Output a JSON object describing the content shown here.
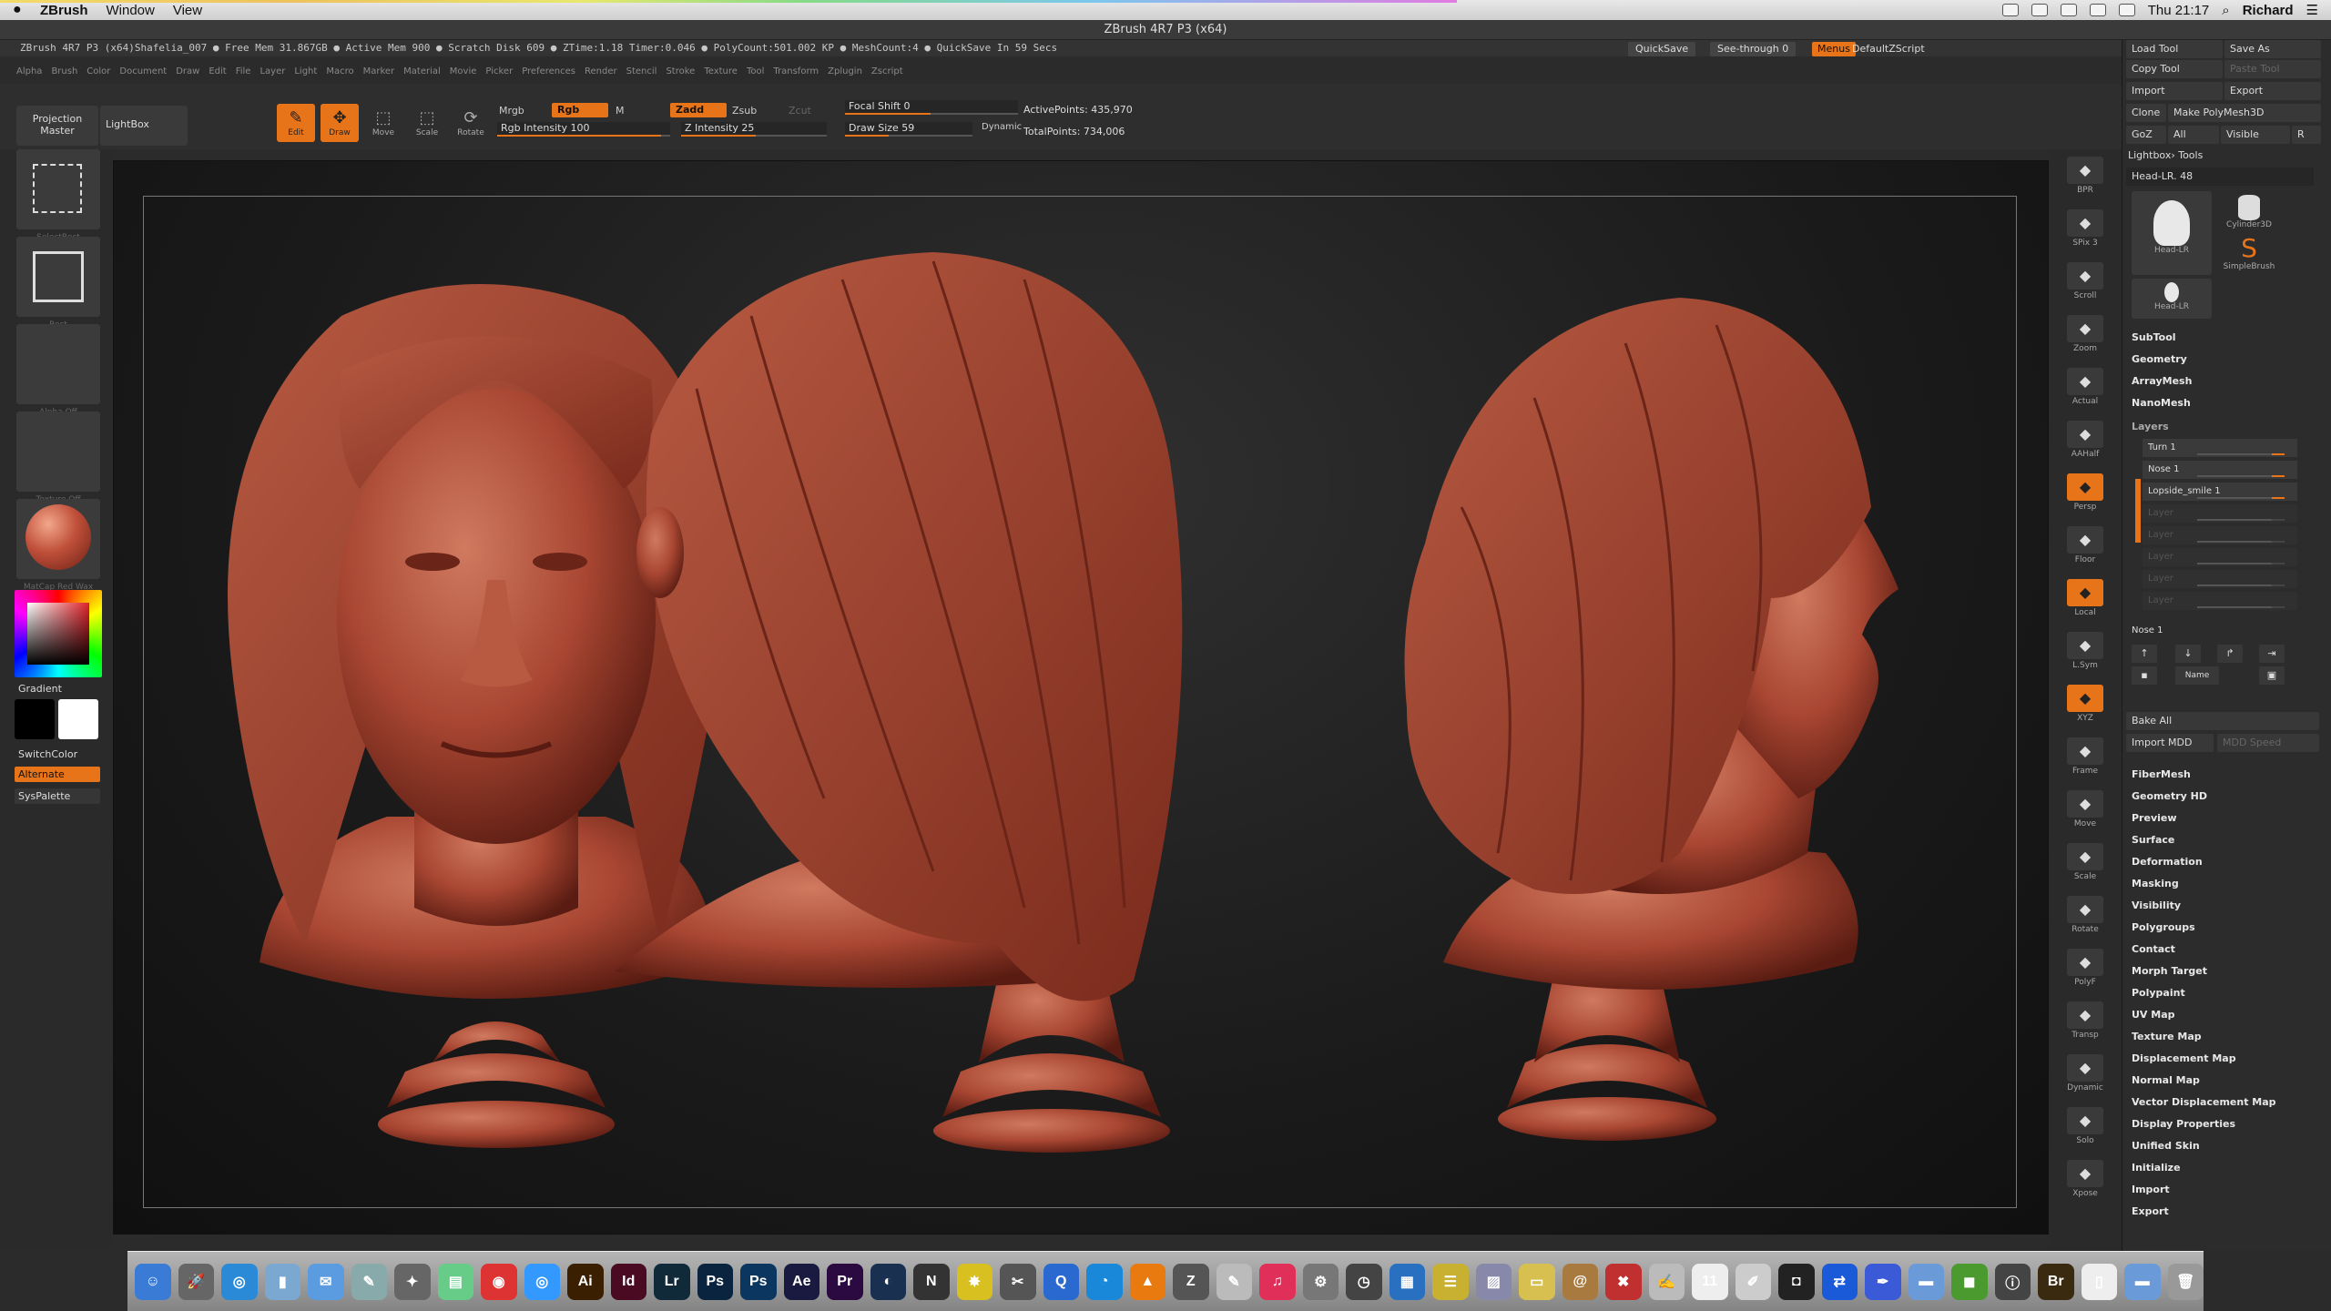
{
  "menubar": {
    "app_name": "ZBrush",
    "items": [
      "Window",
      "View"
    ],
    "clock": "Thu 21:17",
    "user": "Richard"
  },
  "window_title": "ZBrush 4R7 P3 (x64)",
  "info_strip": "ZBrush 4R7 P3 (x64)Shafelia_007   ● Free Mem 31.867GB ● Active Mem 900 ● Scratch Disk 609 ● ZTime:1.18 Timer:0.046 ● PolyCount:501.002 KP ● MeshCount:4 ● QuickSave In 59 Secs",
  "header_right": {
    "quicksave": "QuickSave",
    "see_through": "See-through  0",
    "menus": "Menus",
    "script": "DefaultZScript"
  },
  "menu_names": [
    "Alpha",
    "Brush",
    "Color",
    "Document",
    "Draw",
    "Edit",
    "File",
    "Layer",
    "Light",
    "Macro",
    "Marker",
    "Material",
    "Movie",
    "Picker",
    "Preferences",
    "Render",
    "Stencil",
    "Stroke",
    "Texture",
    "Tool",
    "Transform",
    "Zplugin",
    "Zscript"
  ],
  "toolbar": {
    "projection_master": "Projection Master",
    "lightbox": "LightBox",
    "edit": "Edit",
    "draw": "Draw",
    "move": "Move",
    "scale": "Scale",
    "rotate": "Rotate",
    "mrgb": "Mrgb",
    "rgb": "Rgb",
    "m": "M",
    "zadd": "Zadd",
    "zsub": "Zsub",
    "zcut": "Zcut",
    "rgb_intensity": "Rgb Intensity 100",
    "z_intensity": "Z Intensity 25",
    "focal_shift": "Focal Shift 0",
    "draw_size": "Draw Size 59",
    "dynamic": "Dynamic",
    "active_points": "ActivePoints: 435,970",
    "total_points": "TotalPoints: 734,006"
  },
  "left_shelf": {
    "select_rect": "SelectRect",
    "rect": "Rect",
    "alpha_off": "Alpha Off",
    "texture_off": "Texture Off",
    "matcap": "MatCap Red Wax",
    "gradient": "Gradient",
    "switch_color": "SwitchColor",
    "alternate": "Alternate",
    "syspalette": "SysPalette"
  },
  "right_shelf": [
    {
      "label": "BPR",
      "icon": "bpr-icon",
      "on": false
    },
    {
      "label": "SPix 3",
      "icon": "spix-icon",
      "on": false
    },
    {
      "label": "Scroll",
      "icon": "scroll-icon",
      "on": false
    },
    {
      "label": "Zoom",
      "icon": "zoom-icon",
      "on": false
    },
    {
      "label": "Actual",
      "icon": "actual-icon",
      "on": false
    },
    {
      "label": "AAHalf",
      "icon": "aahalf-icon",
      "on": false
    },
    {
      "label": "Persp",
      "icon": "persp-icon",
      "on": true
    },
    {
      "label": "Floor",
      "icon": "floor-icon",
      "on": false
    },
    {
      "label": "Local",
      "icon": "local-icon",
      "on": true
    },
    {
      "label": "L.Sym",
      "icon": "lsym-icon",
      "on": false
    },
    {
      "label": "XYZ",
      "icon": "xyz-icon",
      "on": true
    },
    {
      "label": "Frame",
      "icon": "frame-icon",
      "on": false
    },
    {
      "label": "Move",
      "icon": "move-icon",
      "on": false
    },
    {
      "label": "Scale",
      "icon": "scale-icon",
      "on": false
    },
    {
      "label": "Rotate",
      "icon": "rotate-icon",
      "on": false
    },
    {
      "label": "PolyF",
      "icon": "polyf-icon",
      "on": false
    },
    {
      "label": "Transp",
      "icon": "transp-icon",
      "on": false
    },
    {
      "label": "Dynamic",
      "icon": "dynamic-icon",
      "on": false
    },
    {
      "label": "Solo",
      "icon": "solo-icon",
      "on": false
    },
    {
      "label": "Xpose",
      "icon": "xpose-icon",
      "on": false
    }
  ],
  "right_panel": {
    "load_tool": "Load Tool",
    "save_as": "Save As",
    "copy_tool": "Copy Tool",
    "paste_tool": "Paste Tool",
    "import": "Import",
    "export": "Export",
    "clone": "Clone",
    "make_polymesh": "Make PolyMesh3D",
    "goz": "GoZ",
    "all": "All",
    "visible": "Visible",
    "r": "R",
    "lightbox_tools": "Lightbox› Tools",
    "head_slider": "Head-LR. 48",
    "thumb_head": "Head-LR",
    "thumb_cylinder": "Cylinder3D",
    "thumb_simplebrush": "SimpleBrush",
    "thumb_head2": "Head-LR",
    "sections_top": [
      "SubTool",
      "Geometry",
      "ArrayMesh",
      "NanoMesh"
    ],
    "layers_title": "Layers",
    "layers": [
      {
        "name": "Turn 1",
        "active": true
      },
      {
        "name": "Nose 1",
        "active": true
      },
      {
        "name": "Lopside_smile 1",
        "active": true
      },
      {
        "name": "Layer",
        "active": false
      },
      {
        "name": "Layer",
        "active": false
      },
      {
        "name": "Layer",
        "active": false
      },
      {
        "name": "Layer",
        "active": false
      },
      {
        "name": "Layer",
        "active": false
      }
    ],
    "nose_slider": "Nose 1",
    "name_btn": "Name",
    "bake_all": "Bake All",
    "import_mdd": "Import MDD",
    "mdd_speed": "MDD Speed",
    "sections_bottom": [
      "FiberMesh",
      "Geometry HD",
      "Preview",
      "Surface",
      "Deformation",
      "Masking",
      "Visibility",
      "Polygroups",
      "Contact",
      "Morph Target",
      "Polypaint",
      "UV Map",
      "Texture Map",
      "Displacement Map",
      "Normal Map",
      "Vector Displacement Map",
      "Display Properties",
      "Unified Skin",
      "Initialize",
      "Import",
      "Export"
    ]
  },
  "dock": [
    {
      "name": "finder-icon",
      "glyph": "☺",
      "color": "#3a7bd5"
    },
    {
      "name": "launchpad-icon",
      "glyph": "🚀",
      "color": "#666"
    },
    {
      "name": "safari-icon",
      "glyph": "◎",
      "color": "#2a8ad8"
    },
    {
      "name": "trash-icon-app",
      "glyph": "▮",
      "color": "#7aa8d0"
    },
    {
      "name": "mail-icon",
      "glyph": "✉",
      "color": "#5b9be0"
    },
    {
      "name": "preview-icon",
      "glyph": "✎",
      "color": "#8aa"
    },
    {
      "name": "app-icon",
      "glyph": "✦",
      "color": "#666"
    },
    {
      "name": "photos-icon",
      "glyph": "▤",
      "color": "#6c8"
    },
    {
      "name": "chrome-icon",
      "glyph": "◉",
      "color": "#d33"
    },
    {
      "name": "safari2-icon",
      "glyph": "◎",
      "color": "#39f"
    },
    {
      "name": "illustrator-icon",
      "glyph": "Ai",
      "color": "#3a1f00"
    },
    {
      "name": "indesign-icon",
      "glyph": "Id",
      "color": "#4a0a22"
    },
    {
      "name": "lightroom-icon",
      "glyph": "Lr",
      "color": "#102a3a"
    },
    {
      "name": "photoshop-icon",
      "glyph": "Ps",
      "color": "#0a2440"
    },
    {
      "name": "photoshop2-icon",
      "glyph": "Ps",
      "color": "#0a3660"
    },
    {
      "name": "aftereffects-icon",
      "glyph": "Ae",
      "color": "#1a1a40"
    },
    {
      "name": "premiere-icon",
      "glyph": "Pr",
      "color": "#2a0a40"
    },
    {
      "name": "cinema4d-icon",
      "glyph": "◐",
      "color": "#1a3050"
    },
    {
      "name": "nuke-icon",
      "glyph": "N",
      "color": "#333"
    },
    {
      "name": "keyshot-icon",
      "glyph": "✸",
      "color": "#d8c020"
    },
    {
      "name": "tool-icon",
      "glyph": "✂",
      "color": "#555"
    },
    {
      "name": "quicktime-icon",
      "glyph": "Q",
      "color": "#2a6ad0"
    },
    {
      "name": "timemachine-icon",
      "glyph": "◔",
      "color": "#1a88d8"
    },
    {
      "name": "vlc-icon",
      "glyph": "▲",
      "color": "#e87a10"
    },
    {
      "name": "zbrush-icon",
      "glyph": "Z",
      "color": "#555"
    },
    {
      "name": "script-icon",
      "glyph": "✎",
      "color": "#bbb"
    },
    {
      "name": "itunes-icon",
      "glyph": "♫",
      "color": "#e0305a"
    },
    {
      "name": "settings-icon",
      "glyph": "⚙",
      "color": "#777"
    },
    {
      "name": "clock-icon",
      "glyph": "◷",
      "color": "#444"
    },
    {
      "name": "chart-icon",
      "glyph": "▦",
      "color": "#2a70c0"
    },
    {
      "name": "notes-icon",
      "glyph": "☰",
      "color": "#c8b030"
    },
    {
      "name": "preview2-icon",
      "glyph": "▨",
      "color": "#88a"
    },
    {
      "name": "stickies-icon",
      "glyph": "▭",
      "color": "#d8c050"
    },
    {
      "name": "contacts-icon",
      "glyph": "@",
      "color": "#a87a40"
    },
    {
      "name": "tools-icon",
      "glyph": "✖",
      "color": "#c03030"
    },
    {
      "name": "scripteditor-icon",
      "glyph": "✍",
      "color": "#bbb"
    },
    {
      "name": "calendar-icon",
      "glyph": "11",
      "color": "#eee"
    },
    {
      "name": "textedit-icon",
      "glyph": "✐",
      "color": "#ccc"
    },
    {
      "name": "terminal-icon",
      "glyph": "◘",
      "color": "#222"
    },
    {
      "name": "teamviewer-icon",
      "glyph": "⇄",
      "color": "#1a5ad8"
    },
    {
      "name": "pen-icon",
      "glyph": "✒",
      "color": "#3a5ad8"
    },
    {
      "name": "folder-icon",
      "glyph": "▬",
      "color": "#6a9ad8"
    },
    {
      "name": "android-icon",
      "glyph": "◼",
      "color": "#4a9a30"
    },
    {
      "name": "info-icon",
      "glyph": "ⓘ",
      "color": "#444"
    },
    {
      "name": "bridge-icon",
      "glyph": "Br",
      "color": "#3a2a10"
    },
    {
      "name": "document-icon",
      "glyph": "▯",
      "color": "#eee"
    },
    {
      "name": "folder2-icon",
      "glyph": "▬",
      "color": "#6a9ad8"
    },
    {
      "name": "trash-icon",
      "glyph": "🗑",
      "color": "#999"
    }
  ],
  "colors": {
    "accent": "#e8741a",
    "clay": "#a84632",
    "canvas_bg": "#1a1a1a"
  }
}
